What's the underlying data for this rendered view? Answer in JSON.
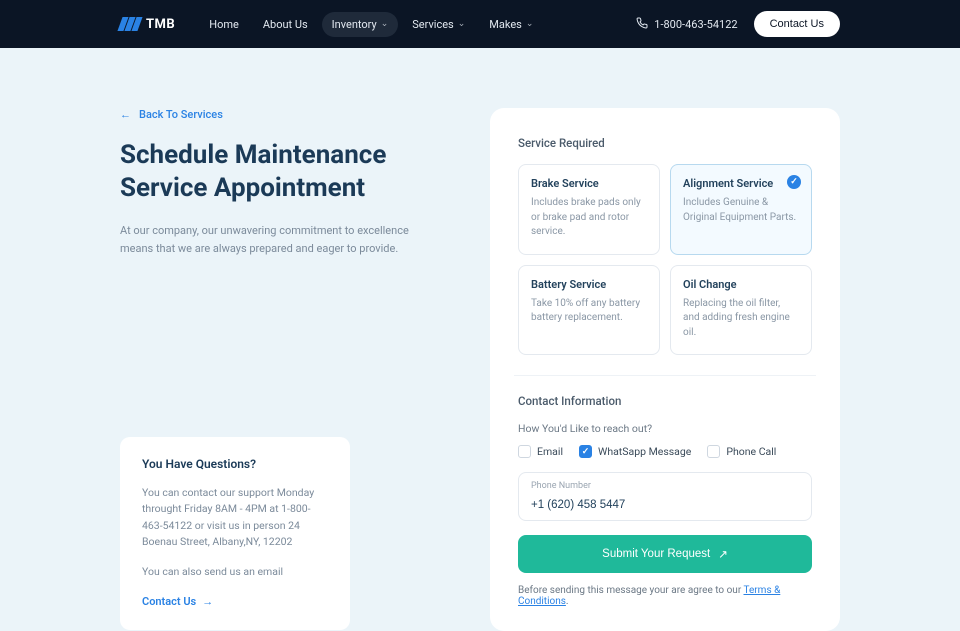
{
  "brand": "TMB",
  "nav": {
    "items": [
      {
        "label": "Home",
        "dropdown": false,
        "active": false
      },
      {
        "label": "About Us",
        "dropdown": false,
        "active": false
      },
      {
        "label": "Inventory",
        "dropdown": true,
        "active": true
      },
      {
        "label": "Services",
        "dropdown": true,
        "active": false
      },
      {
        "label": "Makes",
        "dropdown": true,
        "active": false
      }
    ],
    "phone": "1-800-463-54122",
    "contact_btn": "Contact Us"
  },
  "page": {
    "back_label": "Back To Services",
    "title_line1": "Schedule Maintenance",
    "title_line2": "Service Appointment",
    "intro": "At our company, our unwavering commitment to excellence means that we are always prepared and eager to provide."
  },
  "question_card": {
    "heading": "You Have Questions?",
    "line1": "You can contact our support Monday throught Friday 8AM - 4PM  at 1-800-463-54122 or visit us in person 24 Boenau Street, Albany,NY, 12202",
    "line2": "You can also send us an email",
    "cta": "Contact Us"
  },
  "form": {
    "service_required_label": "Service Required",
    "services": [
      {
        "title": "Brake Service",
        "desc": "Includes brake pads only or brake pad and rotor service.",
        "selected": false
      },
      {
        "title": "Alignment Service",
        "desc": "Includes Genuine & Original Equipment Parts.",
        "selected": true
      },
      {
        "title": "Battery Service",
        "desc": "Take 10% off any battery battery replacement.",
        "selected": false
      },
      {
        "title": "Oil Change",
        "desc": "Replacing the oil filter, and adding fresh engine oil.",
        "selected": false
      }
    ],
    "contact_info_label": "Contact Information",
    "reach_prompt": "How You'd Like to reach out?",
    "reach_options": [
      {
        "label": "Email",
        "checked": false
      },
      {
        "label": "WhatSapp Message",
        "checked": true
      },
      {
        "label": "Phone Call",
        "checked": false
      }
    ],
    "phone_field": {
      "label": "Phone Number",
      "value": "+1 (620) 458 5447"
    },
    "submit_label": "Submit Your Request",
    "terms_prefix": "Before sending this message your are agree to our ",
    "terms_link": "Terms & Conditions",
    "terms_suffix": "."
  }
}
